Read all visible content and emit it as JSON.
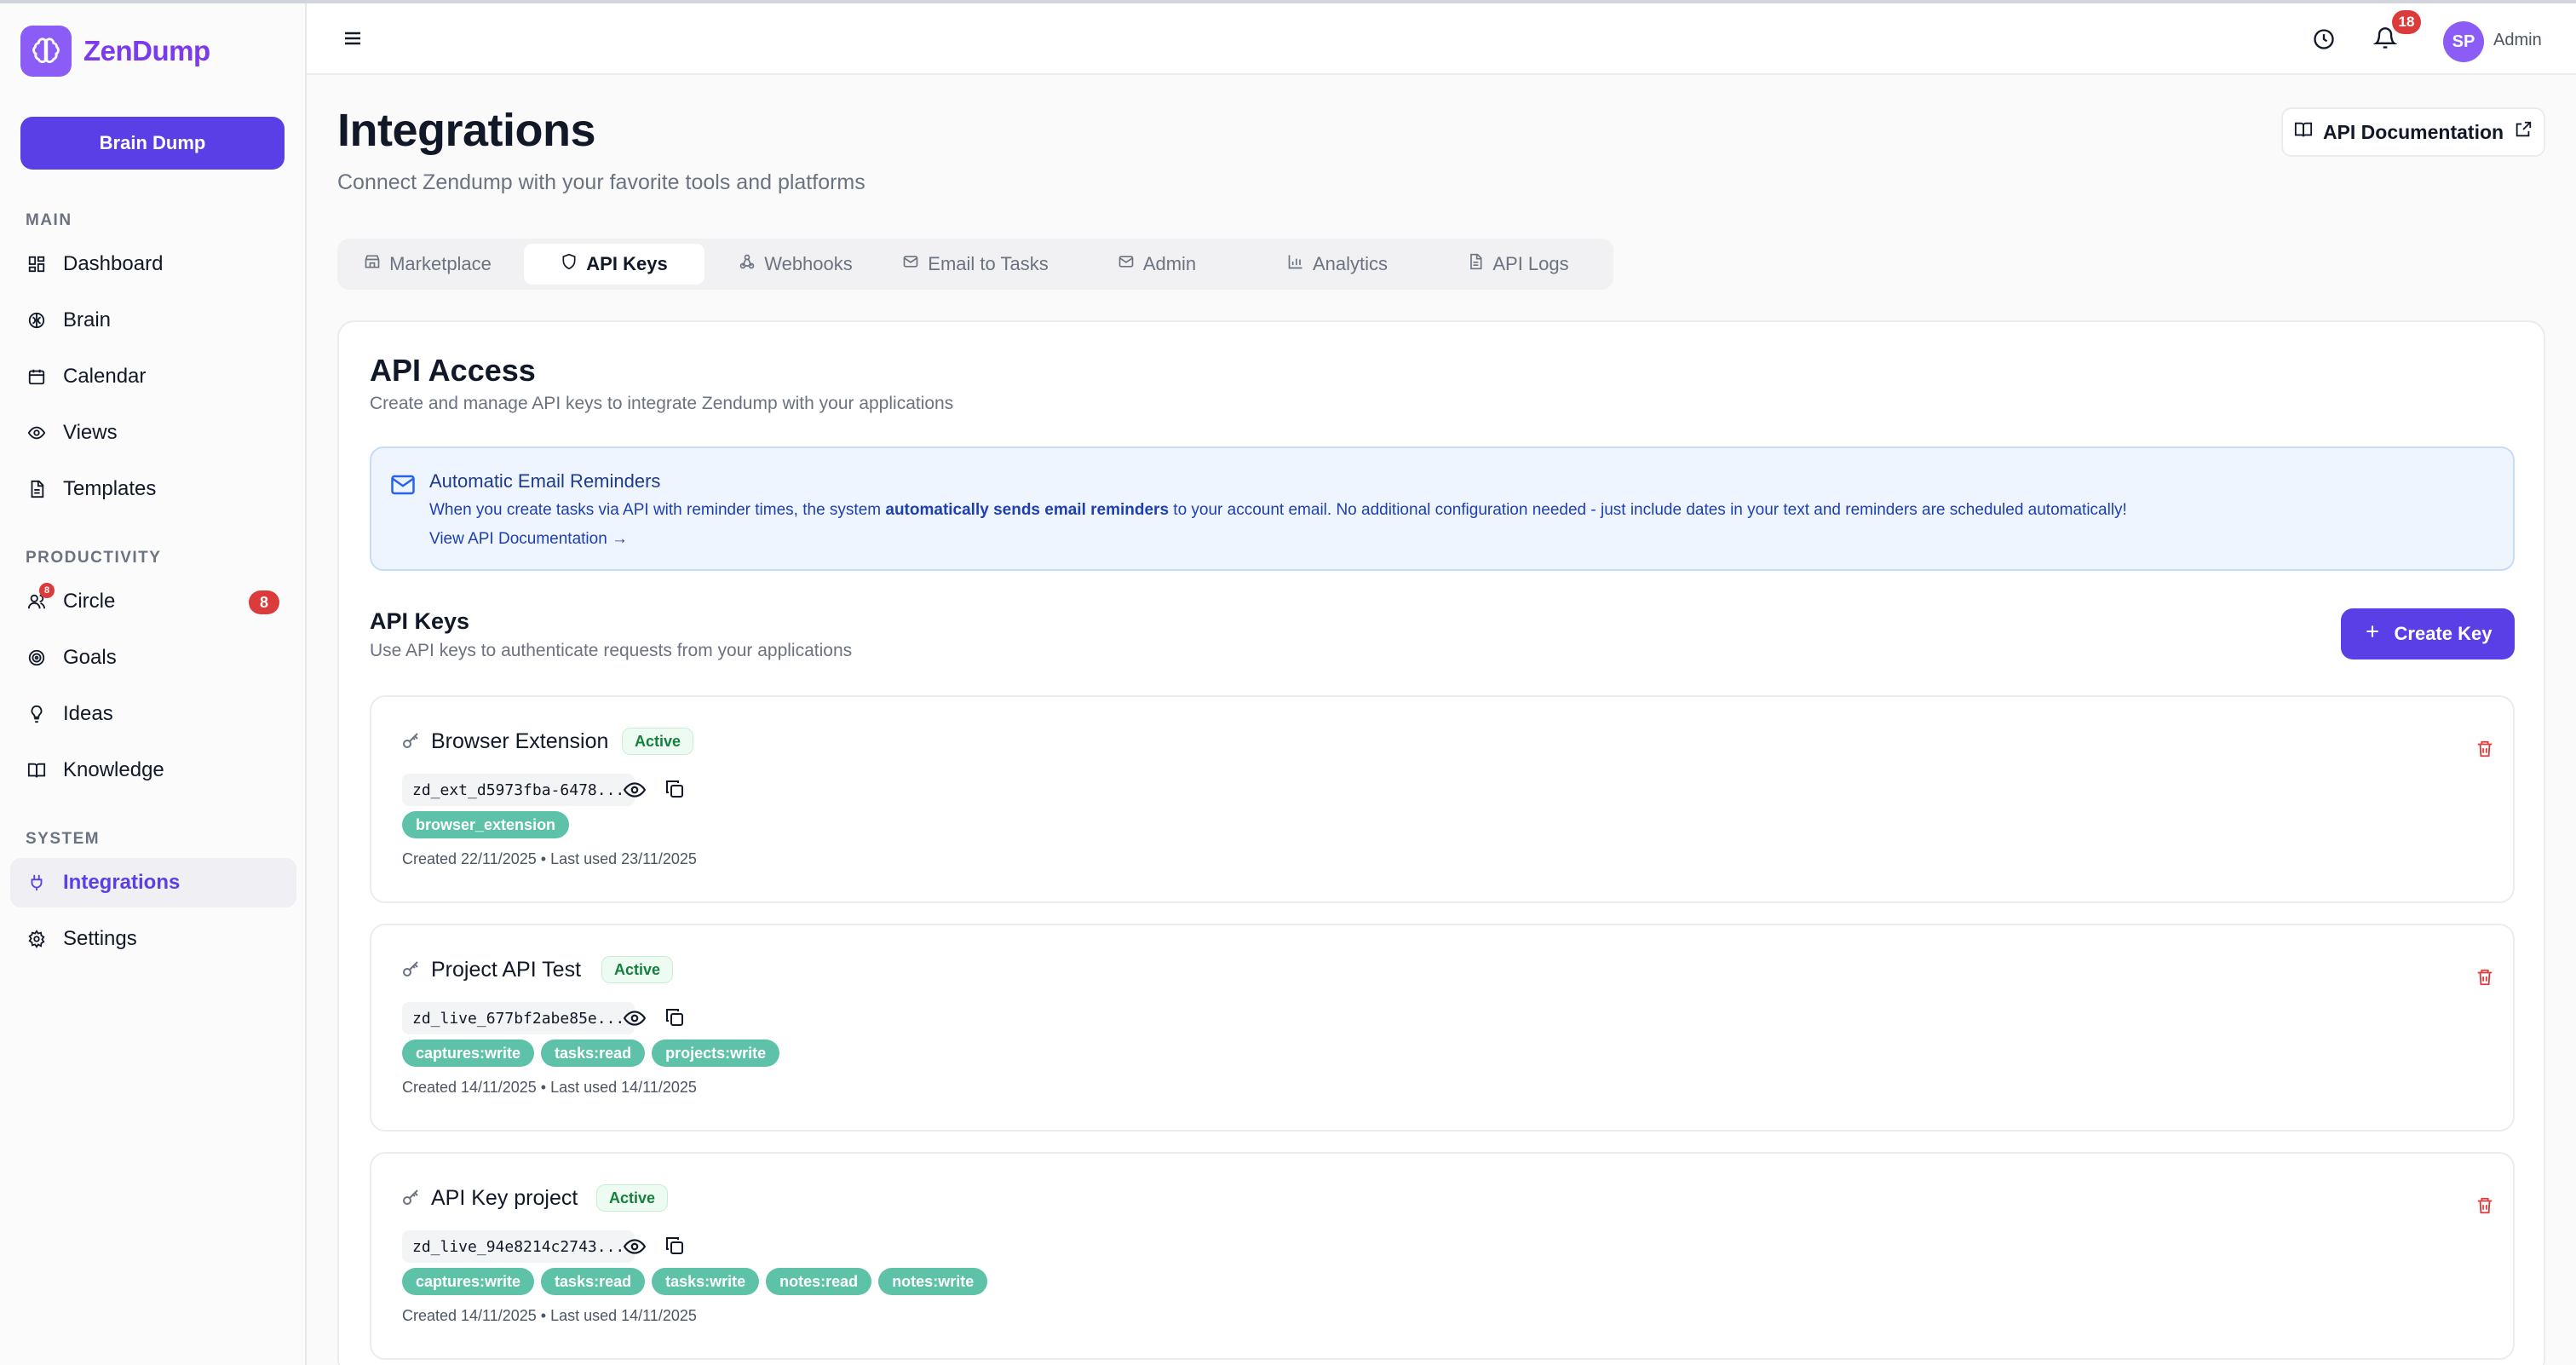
{
  "app": {
    "name": "ZenDump"
  },
  "sidebar": {
    "brain_dump_label": "Brain Dump",
    "sections": {
      "main": "MAIN",
      "productivity": "PRODUCTIVITY",
      "system": "SYSTEM"
    },
    "main_items": [
      {
        "label": "Dashboard",
        "icon": "grid-icon"
      },
      {
        "label": "Brain",
        "icon": "brain-icon"
      },
      {
        "label": "Calendar",
        "icon": "calendar-icon"
      },
      {
        "label": "Views",
        "icon": "eye-icon"
      },
      {
        "label": "Templates",
        "icon": "document-icon"
      }
    ],
    "productivity_items": [
      {
        "label": "Circle",
        "icon": "users-icon",
        "badge": "8",
        "icon_badge": "8"
      },
      {
        "label": "Goals",
        "icon": "target-icon"
      },
      {
        "label": "Ideas",
        "icon": "lightbulb-icon"
      },
      {
        "label": "Knowledge",
        "icon": "book-icon"
      }
    ],
    "system_items": [
      {
        "label": "Integrations",
        "icon": "plug-icon",
        "active": true
      },
      {
        "label": "Settings",
        "icon": "gear-icon"
      }
    ]
  },
  "topbar": {
    "notification_count": "18",
    "avatar_initials": "SP",
    "user_role": "Admin"
  },
  "header": {
    "title": "Integrations",
    "subtitle": "Connect Zendump with your favorite tools and platforms",
    "api_docs_label": "API Documentation"
  },
  "tabs": [
    {
      "label": "Marketplace",
      "icon": "store-icon"
    },
    {
      "label": "API Keys",
      "icon": "shield-icon",
      "active": true
    },
    {
      "label": "Webhooks",
      "icon": "webhook-icon"
    },
    {
      "label": "Email to Tasks",
      "icon": "mail-icon"
    },
    {
      "label": "Admin",
      "icon": "mail-icon"
    },
    {
      "label": "Analytics",
      "icon": "bar-chart-icon"
    },
    {
      "label": "API Logs",
      "icon": "file-text-icon"
    }
  ],
  "api_access": {
    "title": "API Access",
    "subtitle": "Create and manage API keys to integrate Zendump with your applications",
    "info": {
      "title": "Automatic Email Reminders",
      "text_before": "When you create tasks via API with reminder times, the system ",
      "text_bold": "automatically sends email reminders",
      "text_after": " to your account email. No additional configuration needed - just include dates in your text and reminders are scheduled automatically!",
      "link": "View API Documentation →"
    },
    "keys_title": "API Keys",
    "keys_subtitle": "Use API keys to authenticate requests from your applications",
    "create_label": "Create Key",
    "keys": [
      {
        "name": "Browser Extension",
        "status": "Active",
        "code": "zd_ext_d5973fba-6478...",
        "scopes": [
          "browser_extension"
        ],
        "meta": "Created 22/11/2025 • Last used 23/11/2025"
      },
      {
        "name": "Project API Test",
        "status": "Active",
        "code": "zd_live_677bf2abe85e...",
        "scopes": [
          "captures:write",
          "tasks:read",
          "projects:write"
        ],
        "meta": "Created 14/11/2025 • Last used 14/11/2025"
      },
      {
        "name": "API Key project",
        "status": "Active",
        "code": "zd_live_94e8214c2743...",
        "scopes": [
          "captures:write",
          "tasks:read",
          "tasks:write",
          "notes:read",
          "notes:write"
        ],
        "meta": "Created 14/11/2025 • Last used 14/11/2025"
      }
    ]
  }
}
